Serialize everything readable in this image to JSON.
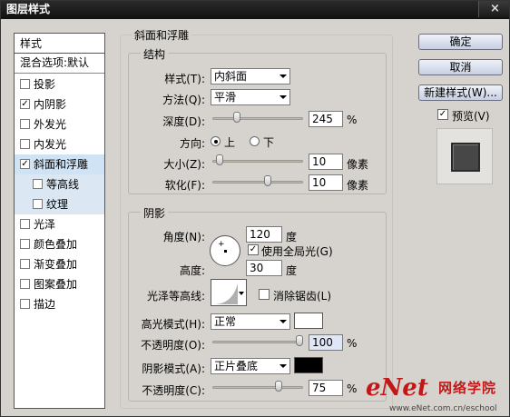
{
  "window": {
    "title": "图层样式",
    "close_glyph": "×"
  },
  "style_list": {
    "header": "样式",
    "blend_options": "混合选项:默认",
    "items": [
      {
        "label": "投影",
        "checked": false
      },
      {
        "label": "内阴影",
        "checked": true
      },
      {
        "label": "外发光",
        "checked": false
      },
      {
        "label": "内发光",
        "checked": false
      },
      {
        "label": "斜面和浮雕",
        "checked": true,
        "selected": true
      },
      {
        "label": "等高线",
        "checked": false,
        "sub": true
      },
      {
        "label": "纹理",
        "checked": false,
        "sub": true
      },
      {
        "label": "光泽",
        "checked": false
      },
      {
        "label": "颜色叠加",
        "checked": false
      },
      {
        "label": "渐变叠加",
        "checked": false
      },
      {
        "label": "图案叠加",
        "checked": false
      },
      {
        "label": "描边",
        "checked": false
      }
    ]
  },
  "bevel": {
    "group_title": "斜面和浮雕",
    "structure": {
      "title": "结构",
      "style_label": "样式(T):",
      "style_value": "内斜面",
      "technique_label": "方法(Q):",
      "technique_value": "平滑",
      "depth_label": "深度(D):",
      "depth_value": "245",
      "depth_unit": "%",
      "depth_fraction": 0.245,
      "direction_label": "方向:",
      "direction_up": "上",
      "direction_down": "下",
      "size_label": "大小(Z):",
      "size_value": "10",
      "size_unit": "像素",
      "size_fraction": 0.04,
      "soften_label": "软化(F):",
      "soften_value": "10",
      "soften_unit": "像素",
      "soften_fraction": 0.62
    },
    "shading": {
      "title": "阴影",
      "angle_label": "角度(N):",
      "angle_value": "120",
      "angle_unit": "度",
      "global_light_label": "使用全局光(G)",
      "global_light_checked": true,
      "altitude_label": "高度:",
      "altitude_value": "30",
      "altitude_unit": "度",
      "gloss_contour_label": "光泽等高线:",
      "anti_alias_label": "消除锯齿(L)",
      "anti_alias_checked": false,
      "highlight_mode_label": "高光模式(H):",
      "highlight_mode_value": "正常",
      "highlight_color": "#ffffff",
      "highlight_opacity_label": "不透明度(O):",
      "highlight_opacity_value": "100",
      "highlight_opacity_unit": "%",
      "highlight_opacity_fraction": 1.0,
      "shadow_mode_label": "阴影模式(A):",
      "shadow_mode_value": "正片叠底",
      "shadow_color": "#000000",
      "shadow_opacity_label": "不透明度(C):",
      "shadow_opacity_value": "75",
      "shadow_opacity_unit": "%",
      "shadow_opacity_fraction": 0.75
    }
  },
  "buttons": {
    "ok": "确定",
    "cancel": "取消",
    "new_style": "新建样式(W)...",
    "preview_label": "预览(V)",
    "preview_checked": true
  },
  "watermark": {
    "brand": "eNet",
    "cn": "网络学院",
    "url": "www.eNet.com.cn/eschool"
  }
}
